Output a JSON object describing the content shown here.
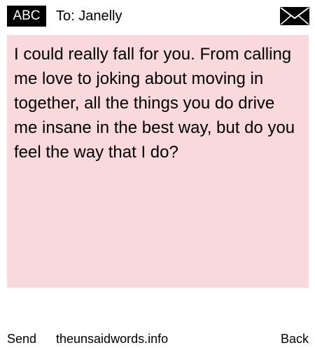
{
  "header": {
    "mode_label": "ABC",
    "recipient": "To: Janelly",
    "envelope_icon": "envelope-icon"
  },
  "message": {
    "text": "I could really fall for you. From calling me love to joking about moving in together, all the things you do drive me insane in the best way, but do you feel the way that I do?",
    "background_color": "#f9d9dc"
  },
  "footer": {
    "send_label": "Send",
    "site_label": "theunsaidwords.info",
    "back_label": "Back"
  }
}
